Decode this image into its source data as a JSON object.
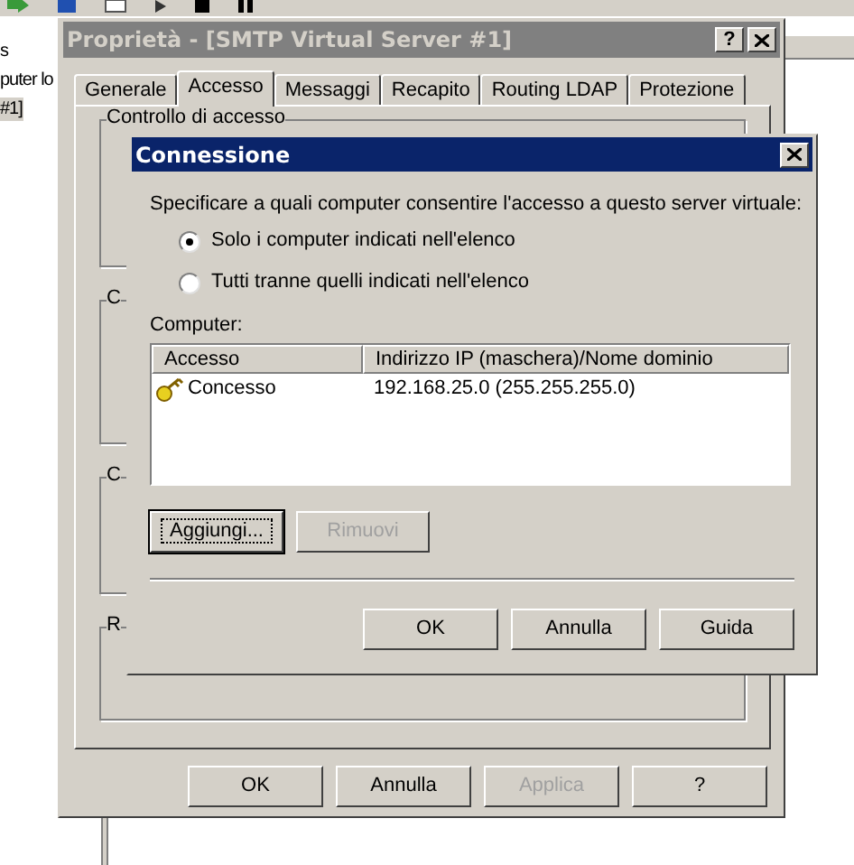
{
  "background": {
    "tree_items": [
      {
        "label": "s",
        "selected": false
      },
      {
        "label": "puter lo",
        "selected": false
      },
      {
        "label": "#1]",
        "selected": true
      }
    ]
  },
  "properties_window": {
    "title": "Proprietà - [SMTP Virtual Server #1]",
    "help_button": "?",
    "tabs": [
      {
        "label": "Generale",
        "selected": false
      },
      {
        "label": "Accesso",
        "selected": true
      },
      {
        "label": "Messaggi",
        "selected": false
      },
      {
        "label": "Recapito",
        "selected": false
      },
      {
        "label": "Routing LDAP",
        "selected": false
      },
      {
        "label": "Protezione",
        "selected": false
      }
    ],
    "group_labels": [
      "Controllo di accesso",
      "C",
      "C",
      "R"
    ],
    "buttons": [
      {
        "label": "OK",
        "disabled": false
      },
      {
        "label": "Annulla",
        "disabled": false
      },
      {
        "label": "Applica",
        "disabled": true
      },
      {
        "label": "?",
        "disabled": false
      }
    ]
  },
  "dialog": {
    "title": "Connessione",
    "prompt": "Specificare a quali computer consentire l'accesso a questo server virtuale:",
    "options": [
      {
        "label": "Solo i computer indicati nell'elenco",
        "selected": true
      },
      {
        "label": "Tutti tranne quelli indicati nell'elenco",
        "selected": false
      }
    ],
    "list_label": "Computer:",
    "columns": [
      "Accesso",
      "Indirizzo IP (maschera)/Nome dominio"
    ],
    "rows": [
      {
        "access": "Concesso",
        "address": "192.168.25.0 (255.255.255.0)"
      }
    ],
    "action_buttons": [
      {
        "label": "Aggiungi...",
        "disabled": false,
        "focused": true
      },
      {
        "label": "Rimuovi",
        "disabled": true,
        "focused": false
      }
    ],
    "buttons": [
      {
        "label": "OK",
        "disabled": false
      },
      {
        "label": "Annulla",
        "disabled": false
      },
      {
        "label": "Guida",
        "disabled": false
      }
    ]
  }
}
